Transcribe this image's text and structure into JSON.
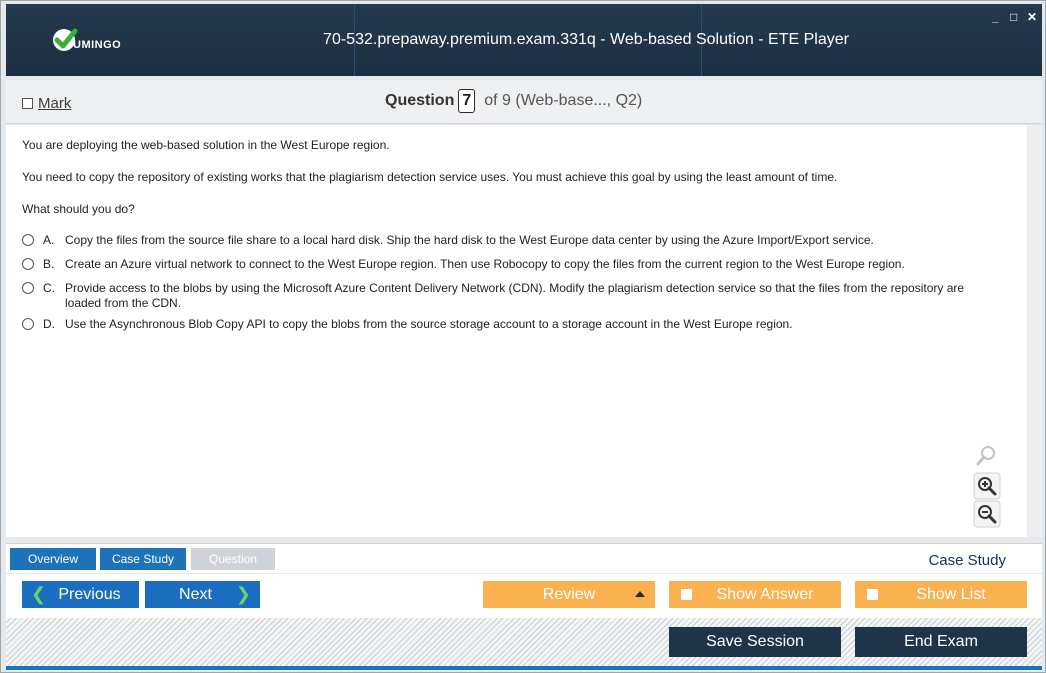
{
  "window": {
    "title": "70-532.prepaway.premium.exam.331q - Web-based Solution - ETE Player",
    "logo_text": "UMINGO",
    "controls": [
      "_",
      "□",
      "✕"
    ]
  },
  "question_bar": {
    "mark_label": "Mark",
    "question_label": "Question",
    "question_number": "7",
    "of_text": "of 9 (Web-base..., Q2)"
  },
  "question": {
    "paragraphs": [
      "You are deploying the web-based solution in the West Europe region.",
      "You need to copy the repository of existing works that the plagiarism detection service uses. You must achieve this goal by using the least amount of time.",
      "What should you do?"
    ],
    "options": [
      {
        "letter": "A.",
        "text": "Copy the files from the source file share to a local hard disk. Ship the hard disk to the West Europe data center by using the Azure Import/Export service."
      },
      {
        "letter": "B.",
        "text": "Create an Azure virtual network to connect to the West Europe region. Then use Robocopy to copy the files from the current region to the West Europe region."
      },
      {
        "letter": "C.",
        "text": "Provide access to the blobs by using the Microsoft Azure Content Delivery Network (CDN). Modify the plagiarism detection service so that the files from the repository are loaded from the CDN."
      },
      {
        "letter": "D.",
        "text": "Use the Asynchronous Blob Copy API to copy the blobs from the source storage account to a storage account in the West Europe region."
      }
    ]
  },
  "tabs": {
    "overview": "Overview",
    "case_study": "Case Study",
    "question": "Question",
    "section_label": "Case Study"
  },
  "nav": {
    "previous": "Previous",
    "next": "Next",
    "review": "Review",
    "show_answer": "Show Answer",
    "show_list": "Show List"
  },
  "footer": {
    "save_session": "Save Session",
    "end_exam": "End Exam"
  },
  "colors": {
    "titlebar": "#1f3447",
    "accent_blue": "#1b6dbf",
    "orange": "#f9b24f",
    "dark_button": "#1e3448"
  }
}
